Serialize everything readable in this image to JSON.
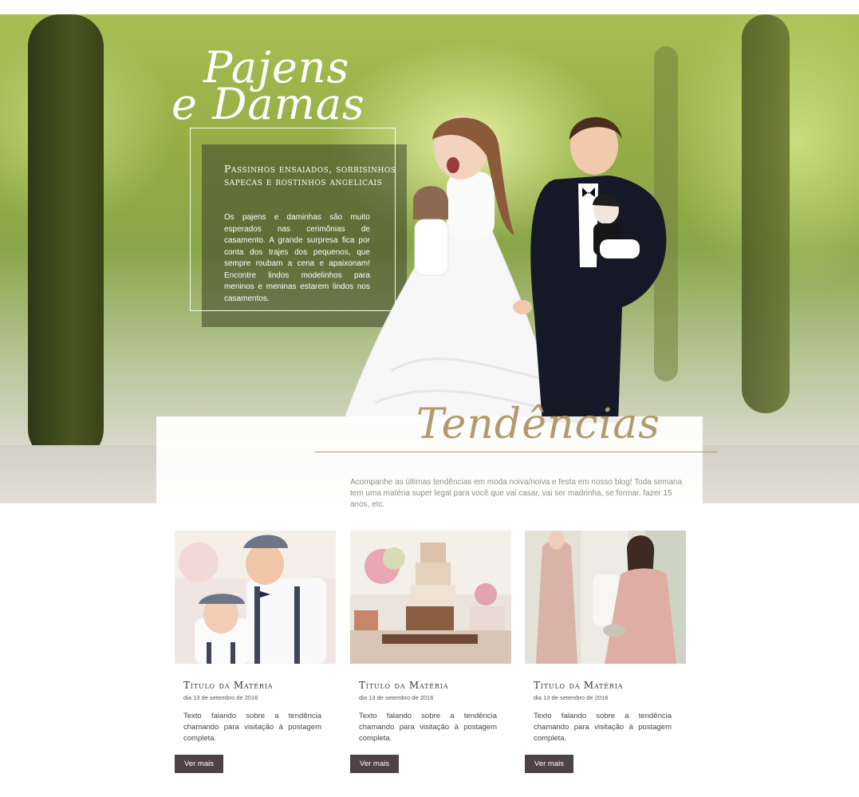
{
  "hero": {
    "script_title_line1": "Pajens",
    "script_title_line2": "e Damas",
    "heading": "Passinhos ensaiados, sorrisinhos sapecas e rostinhos angelicais",
    "text": "Os pajens e daminhas são muito esperados nas cerimônias de casamento. A grande surpresa fica por conta dos trajes dos pequenos, que sempre roubam a cena e apaixonam! Encontre lindos modelinhos para meninos e meninas estarem lindos nos casamentos."
  },
  "trends": {
    "title": "Tendências",
    "text": "Acompanhe as últimas tendências em moda noiva/noiva e festa em nosso blog! Toda semana tem uma matéria super legal para você que vai casar, vai ser madrinha, se formar, fazer 15 anos, etc."
  },
  "cards": [
    {
      "title": "Título da Matéria",
      "date": "dia 13 de setembro de 2016",
      "text": "Texto falando sobre a tendência chamando para visitação à postagem completa.",
      "button": "Ver mais",
      "image": "page-boys-photo"
    },
    {
      "title": "Título da Matéria",
      "date": "dia 13 de setembro de 2016",
      "text": "Texto falando sobre a tendência chamando para visitação à postagem completa.",
      "button": "Ver mais",
      "image": "wedding-cake-table-photo"
    },
    {
      "title": "Título da Matéria",
      "date": "dia 13 de setembro de 2016",
      "text": "Texto falando sobre a tendência chamando para visitação à postagem completa.",
      "button": "Ver mais",
      "image": "bridesmaid-dresses-photo"
    }
  ],
  "colors": {
    "accent_gold": "#b39a6c",
    "button_bg": "#4d4247"
  }
}
